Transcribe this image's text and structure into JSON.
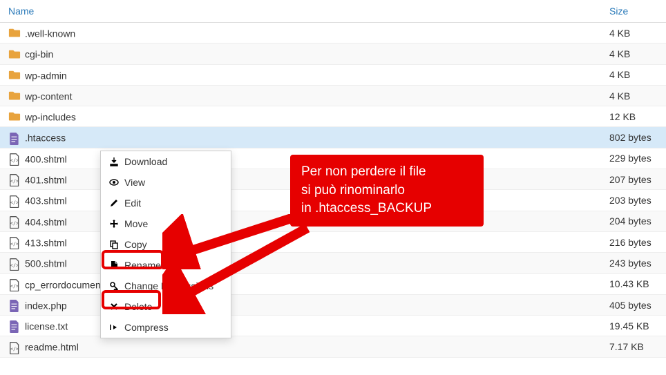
{
  "columns": {
    "name": "Name",
    "size": "Size"
  },
  "files": [
    {
      "type": "folder",
      "name": ".well-known",
      "size": "4 KB"
    },
    {
      "type": "folder",
      "name": "cgi-bin",
      "size": "4 KB"
    },
    {
      "type": "folder",
      "name": "wp-admin",
      "size": "4 KB"
    },
    {
      "type": "folder",
      "name": "wp-content",
      "size": "4 KB"
    },
    {
      "type": "folder",
      "name": "wp-includes",
      "size": "12 KB"
    },
    {
      "type": "file-purple",
      "name": ".htaccess",
      "size": "802 bytes",
      "selected": true
    },
    {
      "type": "file-code",
      "name": "400.shtml",
      "size": "229 bytes"
    },
    {
      "type": "file-code",
      "name": "401.shtml",
      "size": "207 bytes"
    },
    {
      "type": "file-code",
      "name": "403.shtml",
      "size": "203 bytes"
    },
    {
      "type": "file-code",
      "name": "404.shtml",
      "size": "204 bytes"
    },
    {
      "type": "file-code",
      "name": "413.shtml",
      "size": "216 bytes"
    },
    {
      "type": "file-code",
      "name": "500.shtml",
      "size": "243 bytes"
    },
    {
      "type": "file-code",
      "name": "cp_errordocument.shtml",
      "size": "10.43 KB"
    },
    {
      "type": "file-purple",
      "name": "index.php",
      "size": "405 bytes"
    },
    {
      "type": "file-purple",
      "name": "license.txt",
      "size": "19.45 KB"
    },
    {
      "type": "file-code",
      "name": "readme.html",
      "size": "7.17 KB"
    }
  ],
  "context_menu": [
    {
      "icon": "download",
      "label": "Download"
    },
    {
      "icon": "view",
      "label": "View"
    },
    {
      "icon": "edit",
      "label": "Edit"
    },
    {
      "icon": "move",
      "label": "Move"
    },
    {
      "icon": "copy",
      "label": "Copy"
    },
    {
      "icon": "rename",
      "label": "Rename"
    },
    {
      "icon": "permissions",
      "label": "Change Permissions"
    },
    {
      "icon": "delete",
      "label": "Delete"
    },
    {
      "icon": "compress",
      "label": "Compress"
    }
  ],
  "callout": {
    "line1": "Per non perdere il file",
    "line2": "si può rinominarlo",
    "line3": "in .htaccess_BACKUP"
  }
}
